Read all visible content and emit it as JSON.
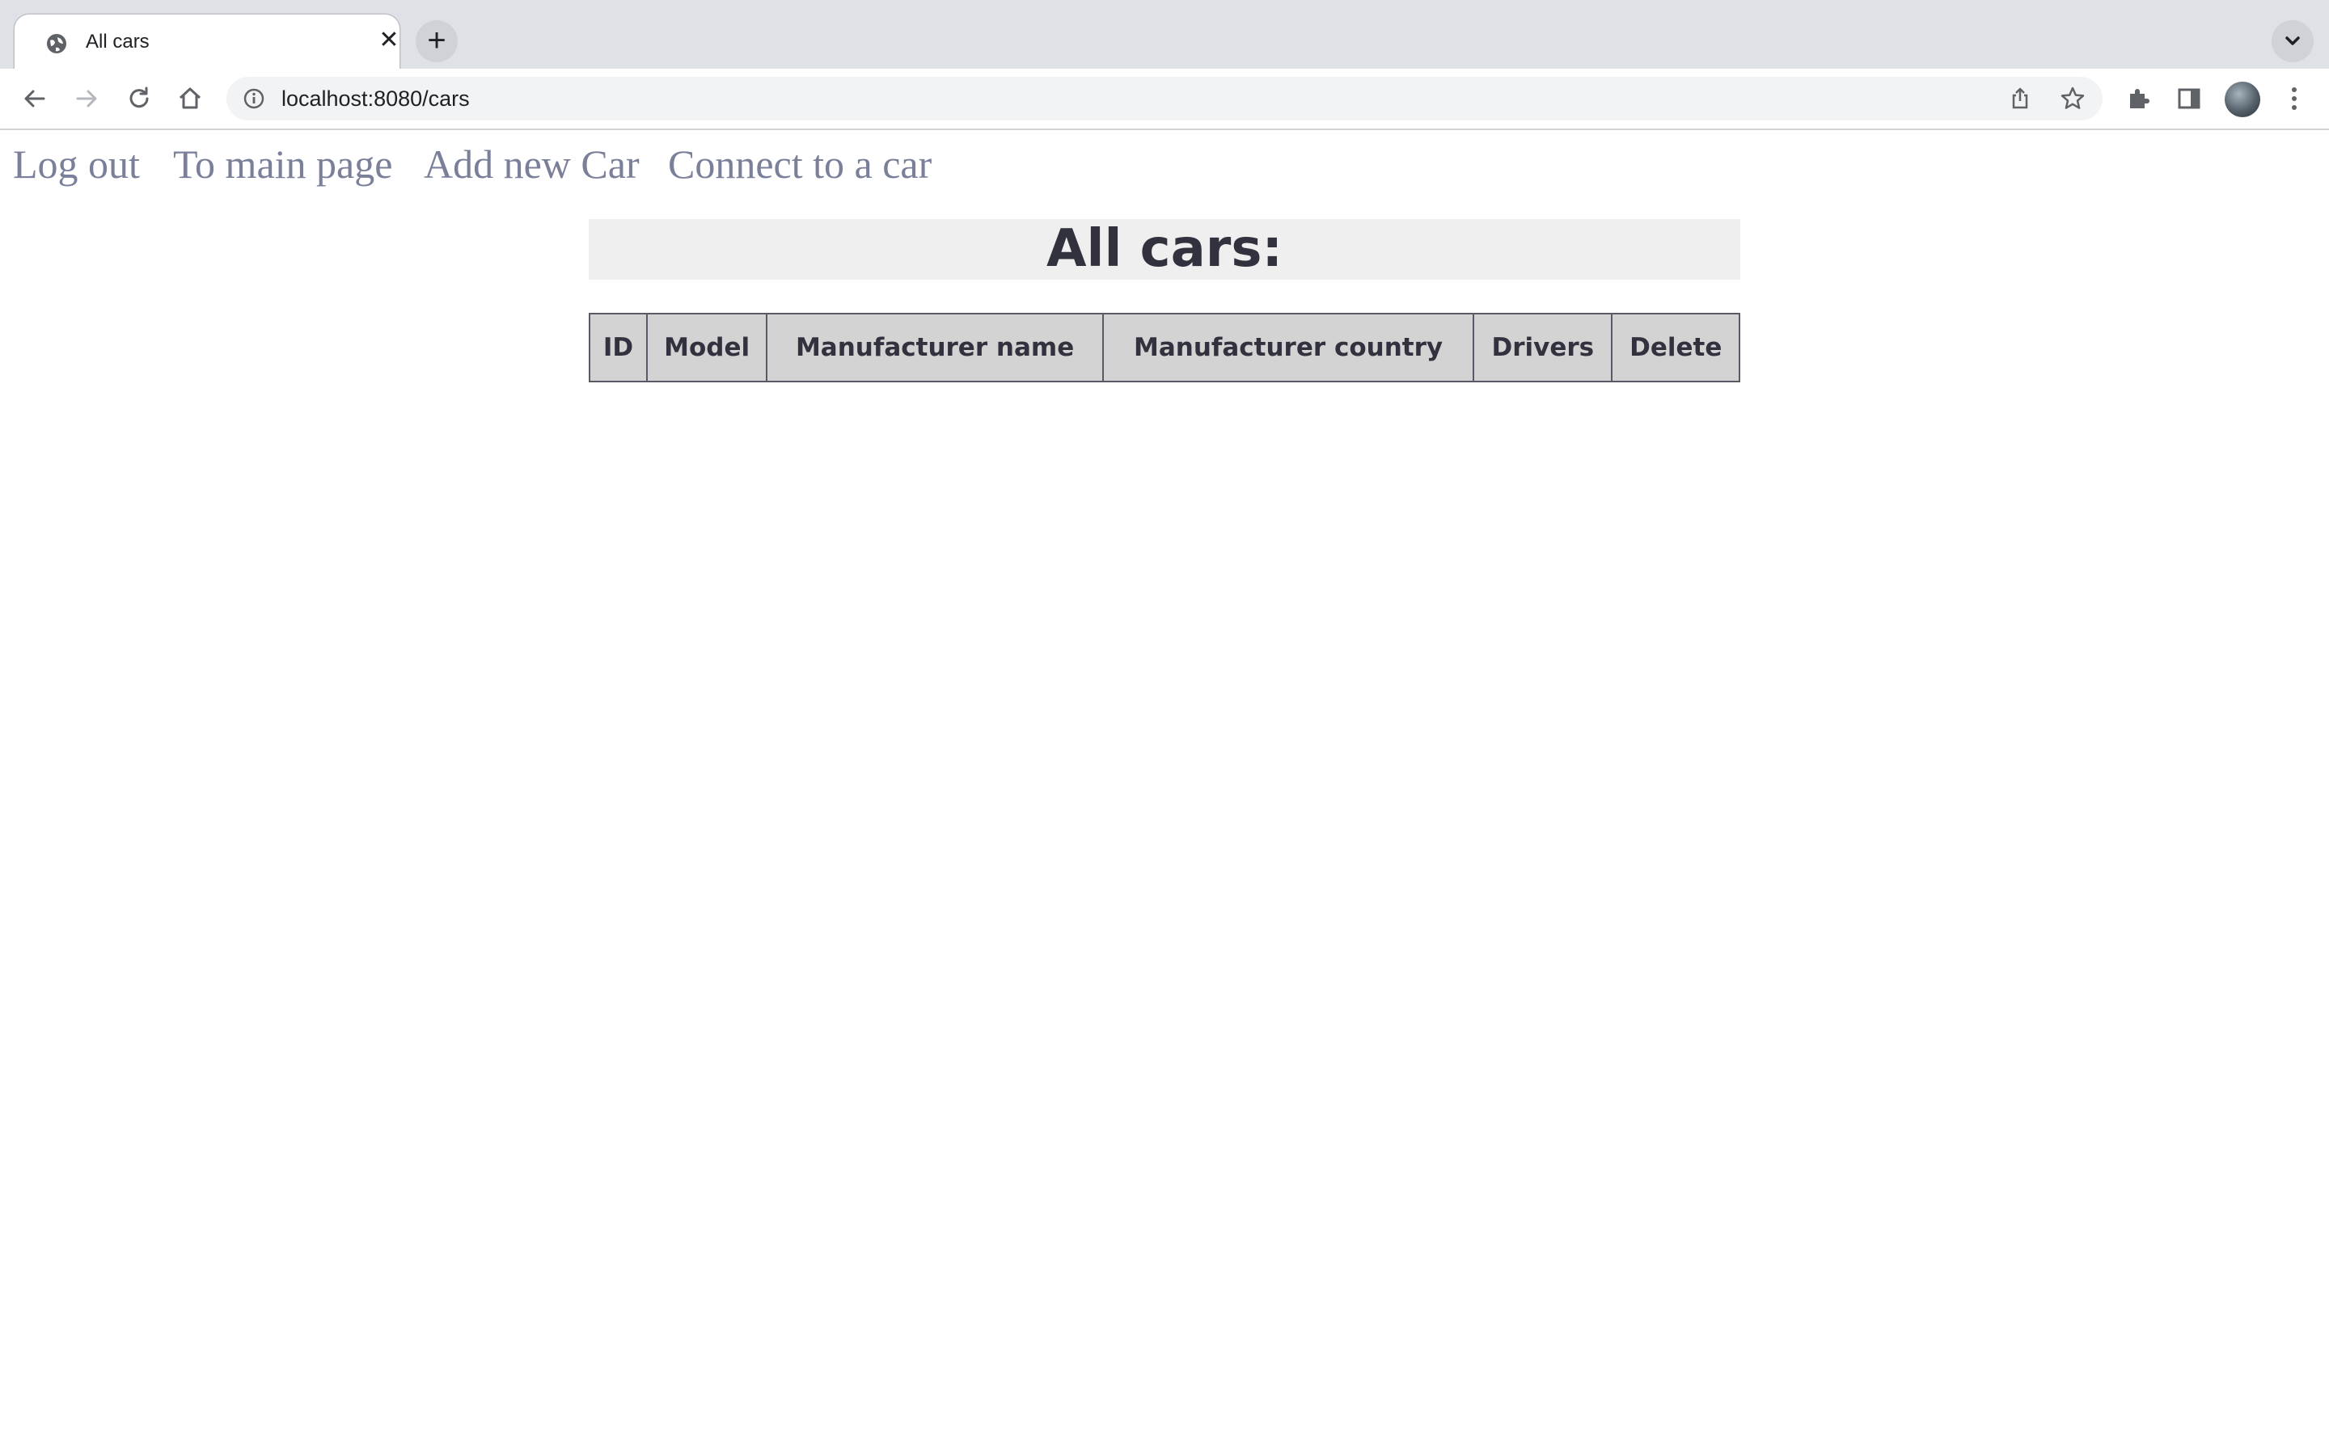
{
  "browser": {
    "tab_title": "All cars",
    "url": "localhost:8080/cars"
  },
  "nav": {
    "links": [
      "Log out",
      "To main page",
      "Add new Car",
      "Connect to a car"
    ]
  },
  "main": {
    "title": "All cars:",
    "table_headers": [
      "ID",
      "Model",
      "Manufacturer name",
      "Manufacturer country",
      "Drivers",
      "Delete"
    ],
    "rows": []
  },
  "colors": {
    "link": "#7a7f9a",
    "heading": "#32323f",
    "header_bg": "#d3d3d3",
    "title_bg": "#efefef"
  }
}
